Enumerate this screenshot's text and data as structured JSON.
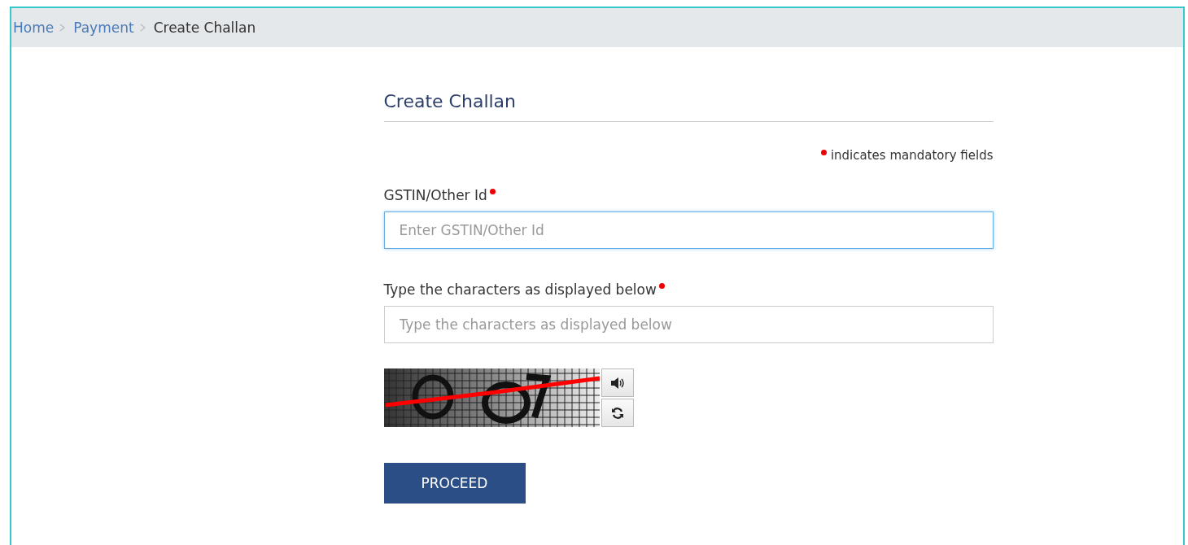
{
  "breadcrumb": [
    {
      "label": "Home",
      "link": true
    },
    {
      "label": "Payment",
      "link": true
    },
    {
      "label": "Create Challan",
      "link": false
    }
  ],
  "form": {
    "title": "Create Challan",
    "mandatory_note": "indicates mandatory fields",
    "fields": [
      {
        "label": "GSTIN/Other Id",
        "required": true,
        "placeholder": "Enter GSTIN/Other Id",
        "focused": true
      },
      {
        "label": "Type the characters as displayed below",
        "required": true,
        "placeholder": "Type the characters as displayed below",
        "focused": false
      }
    ],
    "submit": "PROCEED"
  }
}
